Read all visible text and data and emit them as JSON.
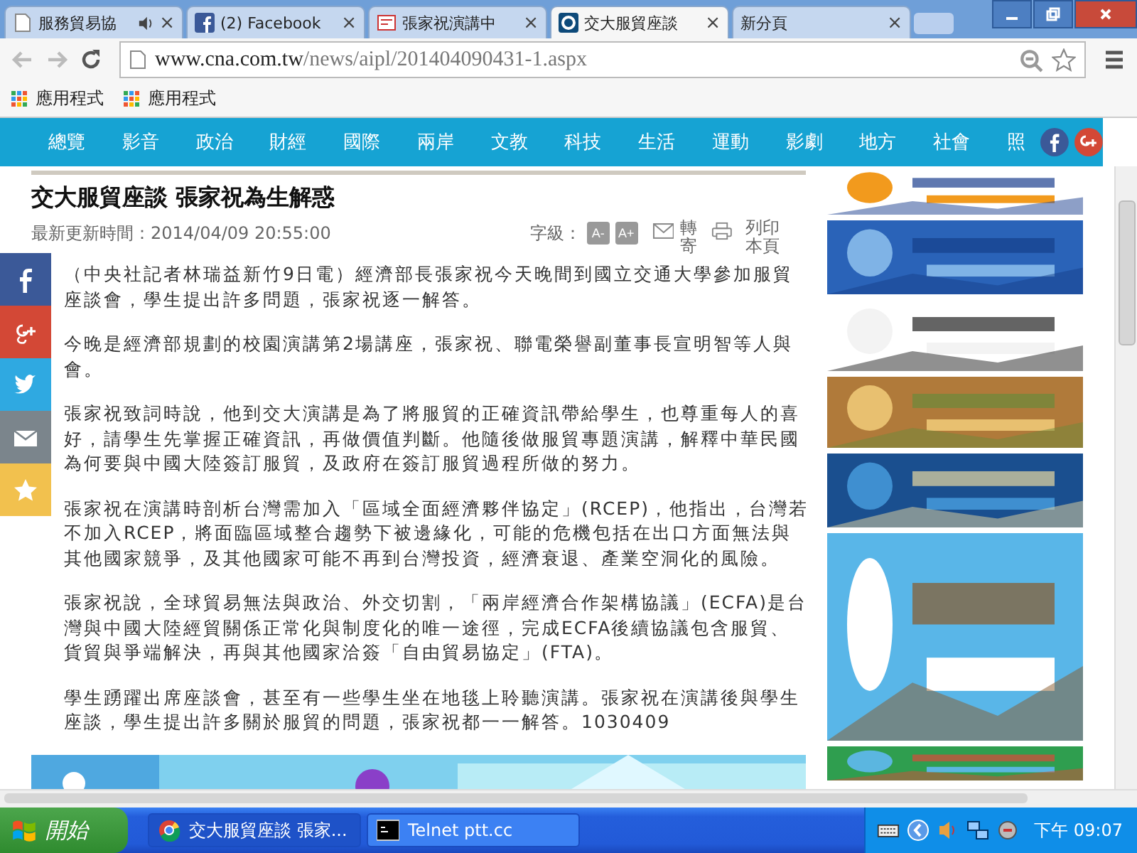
{
  "tabs": [
    {
      "title": "服務貿易協",
      "audio": true,
      "selected": false,
      "close": "×"
    },
    {
      "title": "(2) Facebook",
      "audio": false,
      "selected": false,
      "close": "×"
    },
    {
      "title": "張家祝演講中",
      "audio": false,
      "selected": false,
      "close": "×"
    },
    {
      "title": "交大服貿座談",
      "audio": false,
      "selected": true,
      "close": "×"
    },
    {
      "title": "新分頁",
      "audio": false,
      "selected": false,
      "close": "×"
    }
  ],
  "address": {
    "host": "www.cna.com.tw",
    "path": "/news/aipl/201404090431-1.aspx"
  },
  "bookmarks": [
    "應用程式",
    "應用程式"
  ],
  "nav": [
    "總覽",
    "影音",
    "政治",
    "財經",
    "國際",
    "兩岸",
    "文教",
    "科技",
    "生活",
    "運動",
    "影劇",
    "地方",
    "社會",
    "照"
  ],
  "article": {
    "title": "交大服貿座談 張家祝為生解惑",
    "updated": "最新更新時間：2014/04/09 20:55:00",
    "font_label": "字級：",
    "font_buttons": [
      "A-",
      "A+"
    ],
    "forward": "轉寄",
    "print": "列印本頁",
    "paragraphs": [
      "（中央社記者林瑞益新竹9日電）經濟部長張家祝今天晚間到國立交通大學參加服貿座談會，學生提出許多問題，張家祝逐一解答。",
      "今晚是經濟部規劃的校園演講第2場講座，張家祝、聯電榮譽副董事長宣明智等人與會。",
      "張家祝致詞時說，他到交大演講是為了將服貿的正確資訊帶給學生，也尊重每人的喜好，請學生先掌握正確資訊，再做價值判斷。他隨後做服貿專題演講，解釋中華民國為何要與中國大陸簽訂服貿，及政府在簽訂服貿過程所做的努力。",
      "張家祝在演講時剖析台灣需加入「區域全面經濟夥伴協定」(RCEP)，他指出，台灣若不加入RCEP，將面臨區域整合趨勢下被邊緣化，可能的危機包括在出口方面無法與其他國家競爭，及其他國家可能不再到台灣投資，經濟衰退、產業空洞化的風險。",
      "張家祝說，全球貿易無法與政治、外交切割，「兩岸經濟合作架構協議」(ECFA)是台灣與中國大陸經貿關係正常化與制度化的唯一途徑，完成ECFA後續協議包含服貿、貨貿與爭端解決，再與其他國家洽簽「自由貿易協定」(FTA)。",
      "學生踴躍出席座談會，甚至有一些學生坐在地毯上聆聽演講。張家祝在演講後與學生座談，學生提出許多關於服貿的問題，張家祝都一一解答。1030409"
    ]
  },
  "share": [
    {
      "kind": "facebook",
      "color": "#3b5998"
    },
    {
      "kind": "googleplus",
      "color": "#d34836"
    },
    {
      "kind": "twitter",
      "color": "#2fa9e1"
    },
    {
      "kind": "mail",
      "color": "#7b858c"
    },
    {
      "kind": "star",
      "color": "#f2c14e"
    }
  ],
  "taskbar": {
    "start": "開始",
    "tasks": [
      {
        "title": "交大服貿座談 張家...",
        "selected": true
      },
      {
        "title": "Telnet ptt.cc",
        "selected": false
      }
    ],
    "clock": "下午 09:07"
  }
}
